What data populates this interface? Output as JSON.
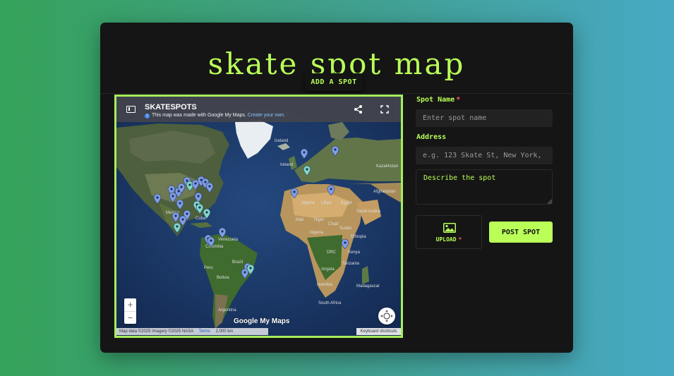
{
  "title": "skate spot map",
  "add_spot_button": "ADD A SPOT",
  "map": {
    "name": "SKATESPOTS",
    "made_with": "This map was made with Google My Maps.",
    "create_link": "Create your own.",
    "logo": "Google My Maps",
    "attribution": "Map data ©2025 Imagery ©2025 NASA",
    "terms": "Terms",
    "scale": "2,000 km",
    "keyboard_shortcuts": "Keyboard shortcuts",
    "zoom_in": "+",
    "zoom_out": "−",
    "icons": [
      "sidebar-icon",
      "star-icon",
      "info-icon",
      "share-icon",
      "fullscreen-icon",
      "locate-icon",
      "map-pin-icon"
    ],
    "labels": {
      "iceland": "Iceland",
      "ireland": "Ireland",
      "kazakhstan": "Kazakhstan",
      "afghanistan": "Afghanistan",
      "algeria": "Algeria",
      "libya": "Libya",
      "egypt": "Egypt",
      "saudi_arabia": "Saudi Arabia",
      "mali": "Mali",
      "niger": "Niger",
      "chad": "Chad",
      "sudan": "Sudan",
      "nigeria": "Nigeria",
      "ethiopia": "Ethiopia",
      "kenya": "Kenya",
      "drc": "DRC",
      "tanzania": "Tanzania",
      "angola": "Angola",
      "namibia": "Namibia",
      "south_africa": "South Africa",
      "madagascar": "Madagascar",
      "venezuela": "Venezuela",
      "colombia": "Colombia",
      "peru": "Peru",
      "brazil": "Brazil",
      "bolivia": "Bolivia",
      "argentina": "Argentina",
      "mexico": "Mexico",
      "cuba": "Cuba"
    }
  },
  "form": {
    "spot_name_label": "Spot Name",
    "required_mark": "*",
    "spot_name_placeholder": "Enter spot name",
    "address_label": "Address",
    "address_placeholder": "e.g. 123 Skate St, New York, NY",
    "description_placeholder": "Describe the spot",
    "upload_label": "UPLOAD",
    "upload_icon": "image-icon",
    "post_button": "POST SPOT"
  },
  "colors": {
    "accent": "#b9ff58",
    "card": "#151515",
    "required": "#ff5b5b",
    "map_border": "#a6ee5b",
    "pin_blue": "#7f9ee8",
    "pin_teal": "#7fd8c4"
  }
}
